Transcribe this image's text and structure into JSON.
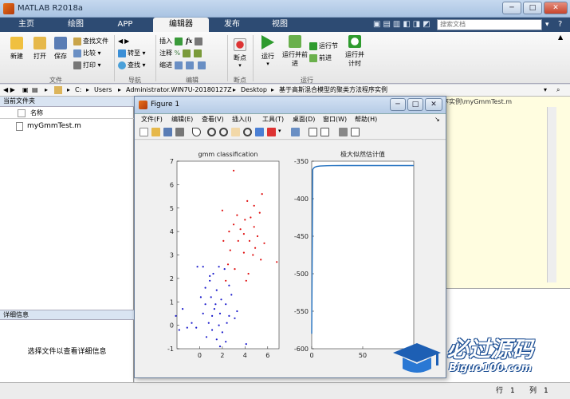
{
  "window": {
    "title": "MATLAB R2018a",
    "min": "─",
    "max": "□",
    "close": "✕"
  },
  "tabs": [
    "主页",
    "绘图",
    "APP",
    "编辑器",
    "发布",
    "视图"
  ],
  "search": {
    "placeholder": "搜索文档"
  },
  "ribbon": {
    "file": {
      "new": "新建",
      "open": "打开",
      "save": "保存",
      "find_files": "查找文件",
      "compare": "比较",
      "print": "打印",
      "group": "文件"
    },
    "nav": {
      "goto": "转至",
      "find": "查找",
      "group": "导航"
    },
    "edit": {
      "insert": "插入",
      "comment": "注释",
      "indent": "缩进",
      "group": "编辑"
    },
    "breakpoints": {
      "label": "断点",
      "group": "断点"
    },
    "run": {
      "run": "运行",
      "run_advance": "运行并前进",
      "run_section": "运行节",
      "advance": "前进",
      "run_time": "运行并计时",
      "group": "运行"
    }
  },
  "path": {
    "drive": "C:",
    "parts": [
      "Users",
      "Administrator.WIN7U-20180127Z",
      "Desktop",
      "基于高斯混合模型的聚类方法程序实例"
    ]
  },
  "left_panel": {
    "title": "当前文件夹",
    "column": "名称",
    "file": "myGmmTest.m",
    "details_title": "详细信息",
    "details_msg": "选择文件以查看详细信息"
  },
  "editor": {
    "title": "序实例\\myGmmTest.m"
  },
  "status": {
    "row_label": "行",
    "row": "1",
    "col_label": "列",
    "col": "1"
  },
  "figure": {
    "title": "Figure 1",
    "menus": [
      "文件(F)",
      "编辑(E)",
      "查看(V)",
      "插入(I)",
      "工具(T)",
      "桌面(D)",
      "窗口(W)",
      "帮助(H)"
    ]
  },
  "watermark": {
    "text": "必过源码",
    "url": "Biguo100.com"
  },
  "colors": {
    "red_cluster": "#e01010",
    "blue_cluster": "#1a1acc",
    "likelihood_line": "#1f6fbf"
  },
  "chart_data": [
    {
      "type": "scatter",
      "title": "gmm classification",
      "xlim": [
        -2,
        7
      ],
      "ylim": [
        -1,
        7
      ],
      "xticks": [
        0,
        2,
        4,
        6
      ],
      "yticks": [
        -1,
        0,
        1,
        2,
        3,
        4,
        5,
        6,
        7
      ],
      "series": [
        {
          "color": "#e01010",
          "points": [
            [
              3,
              6.6
            ],
            [
              4.2,
              5.3
            ],
            [
              5.5,
              5.6
            ],
            [
              4.8,
              5.1
            ],
            [
              2,
              4.9
            ],
            [
              3.3,
              4.7
            ],
            [
              4,
              4.5
            ],
            [
              4.5,
              4.6
            ],
            [
              5.3,
              4.8
            ],
            [
              3,
              4.3
            ],
            [
              3.6,
              4.1
            ],
            [
              4.8,
              4.2
            ],
            [
              2.6,
              4.0
            ],
            [
              3.9,
              3.9
            ],
            [
              5.1,
              3.8
            ],
            [
              2.1,
              3.6
            ],
            [
              3.4,
              3.6
            ],
            [
              4.4,
              3.6
            ],
            [
              5.7,
              3.5
            ],
            [
              4.9,
              3.3
            ],
            [
              2.7,
              3.2
            ],
            [
              3.9,
              3.1
            ],
            [
              4.7,
              3.0
            ],
            [
              6.8,
              2.7
            ],
            [
              5.4,
              2.8
            ],
            [
              2.5,
              2.6
            ],
            [
              3.1,
              2.4
            ],
            [
              4.3,
              2.2
            ],
            [
              4.1,
              1.9
            ],
            [
              2.3,
              1.9
            ]
          ]
        },
        {
          "color": "#1a1acc",
          "points": [
            [
              -0.2,
              2.5
            ],
            [
              0.3,
              2.5
            ],
            [
              1.2,
              2.2
            ],
            [
              0.9,
              2.1
            ],
            [
              1.7,
              2.5
            ],
            [
              2.2,
              2.4
            ],
            [
              0.5,
              1.6
            ],
            [
              1.5,
              1.5
            ],
            [
              2.6,
              1.7
            ],
            [
              0.1,
              1.2
            ],
            [
              1.0,
              1.2
            ],
            [
              1.9,
              1.1
            ],
            [
              2.8,
              1.3
            ],
            [
              0.5,
              0.9
            ],
            [
              1.3,
              0.7
            ],
            [
              2.3,
              0.9
            ],
            [
              -1.5,
              0.7
            ],
            [
              0.3,
              0.5
            ],
            [
              1.1,
              0.4
            ],
            [
              1.8,
              0.5
            ],
            [
              2.6,
              0.4
            ],
            [
              3.3,
              0.6
            ],
            [
              -2.1,
              0.4
            ],
            [
              -0.7,
              0.1
            ],
            [
              0.8,
              0.1
            ],
            [
              1.7,
              0.0
            ],
            [
              2.4,
              0.1
            ],
            [
              -1.8,
              -0.2
            ],
            [
              -0.3,
              -0.1
            ],
            [
              1.1,
              -0.2
            ],
            [
              2.0,
              -0.3
            ],
            [
              -1.1,
              -0.1
            ],
            [
              0.6,
              -0.5
            ],
            [
              1.5,
              -0.6
            ],
            [
              2.3,
              -0.7
            ],
            [
              1.8,
              -0.9
            ],
            [
              4.1,
              -0.8
            ],
            [
              3.1,
              0.3
            ],
            [
              1.4,
              0.9
            ],
            [
              0.9,
              1.9
            ]
          ]
        }
      ]
    },
    {
      "type": "line",
      "title": "极大似然估计值",
      "xlim": [
        0,
        100
      ],
      "ylim": [
        -600,
        -350
      ],
      "xticks": [
        0,
        50
      ],
      "yticks": [
        -350,
        -400,
        -450,
        -500,
        -550,
        -600
      ],
      "series": [
        {
          "color": "#1f6fbf",
          "x": [
            0,
            1,
            2,
            3,
            4,
            5,
            6,
            8,
            10,
            15,
            20,
            30,
            40,
            50,
            60,
            70,
            80,
            90,
            100
          ],
          "y": [
            -580,
            -361,
            -359,
            -358,
            -357.5,
            -357,
            -356.8,
            -356.5,
            -356.3,
            -356.1,
            -356,
            -355.9,
            -355.9,
            -355.8,
            -355.8,
            -355.8,
            -355.8,
            -355.8,
            -355.8
          ]
        }
      ]
    }
  ]
}
